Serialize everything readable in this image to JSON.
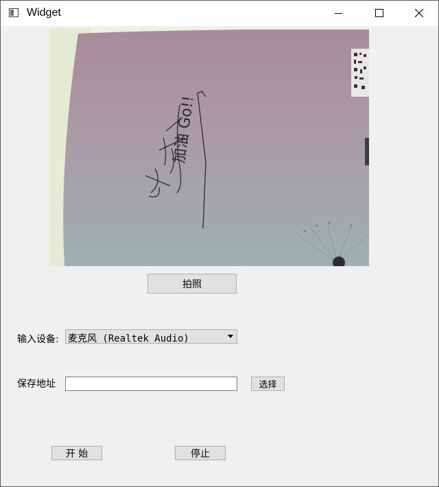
{
  "window": {
    "title": "Widget",
    "icon": "app-window-icon",
    "controls": [
      "minimize-icon",
      "maximize-icon",
      "close-icon"
    ]
  },
  "camera": {
    "handwriting": "加油 Go!!"
  },
  "capture_button": {
    "label": "拍照"
  },
  "input_device": {
    "label": "输入设备:",
    "selected": "麦克风 (Realtek Audio)"
  },
  "save_path": {
    "label": "保存地址",
    "value": "",
    "browse_label": "选择"
  },
  "controls": {
    "start_label": "开 始",
    "stop_label": "停止"
  }
}
